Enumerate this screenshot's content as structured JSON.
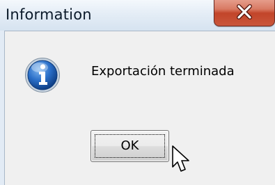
{
  "dialog": {
    "title": "Information",
    "message": "Exportación terminada",
    "ok_label": "OK",
    "icon": "information-icon",
    "close_icon": "close-x-icon"
  },
  "colors": {
    "close_button": "#c9563b",
    "info_icon": "#1d5fb3",
    "client_bg": "#f0f0f0"
  }
}
